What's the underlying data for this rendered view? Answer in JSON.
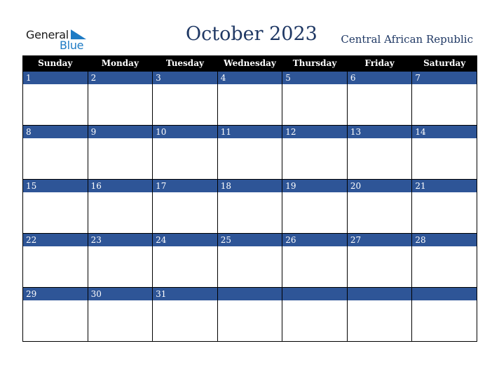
{
  "logo": {
    "word1": "General",
    "word2": "Blue",
    "accent_color": "#1e7bc4"
  },
  "header": {
    "title": "October 2023",
    "country": "Central African Republic",
    "title_color": "#1f3864"
  },
  "calendar": {
    "header_bg": "#000000",
    "daynum_bg": "#2e5597",
    "weekdays": [
      "Sunday",
      "Monday",
      "Tuesday",
      "Wednesday",
      "Thursday",
      "Friday",
      "Saturday"
    ],
    "weeks": [
      [
        "1",
        "2",
        "3",
        "4",
        "5",
        "6",
        "7"
      ],
      [
        "8",
        "9",
        "10",
        "11",
        "12",
        "13",
        "14"
      ],
      [
        "15",
        "16",
        "17",
        "18",
        "19",
        "20",
        "21"
      ],
      [
        "22",
        "23",
        "24",
        "25",
        "26",
        "27",
        "28"
      ],
      [
        "29",
        "30",
        "31",
        "",
        "",
        "",
        ""
      ]
    ]
  }
}
